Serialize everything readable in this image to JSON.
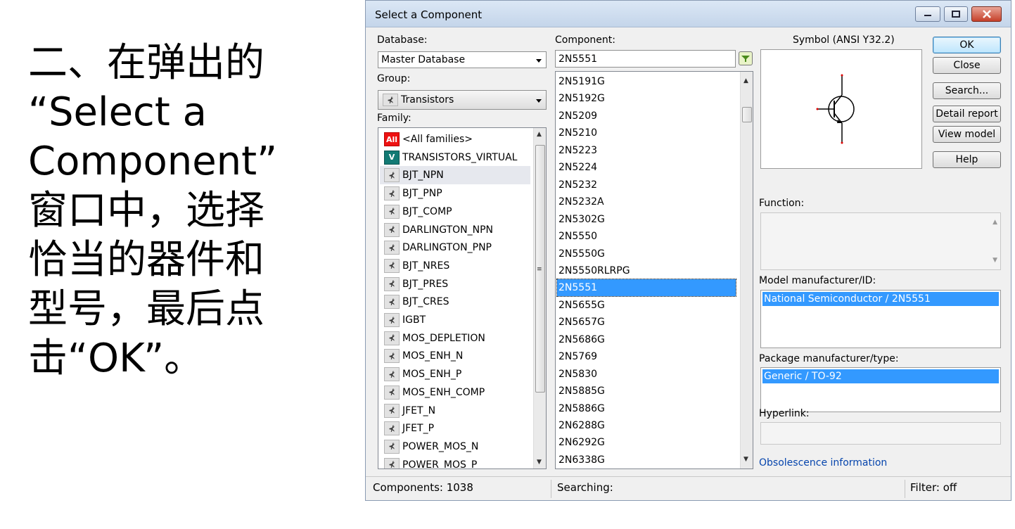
{
  "slide": {
    "lines": [
      "二、在弹出的",
      "“Select a",
      "Component”",
      "窗口中，选择",
      "恰当的器件和",
      "型号，最后点",
      "击“OK”。"
    ]
  },
  "dialog": {
    "title": "Select a Component",
    "database_label": "Database:",
    "database_value": "Master Database",
    "group_label": "Group:",
    "group_value": "Transistors",
    "family_label": "Family:",
    "families": [
      {
        "label": "<All families>",
        "icon": "All",
        "style": "red"
      },
      {
        "label": "TRANSISTORS_VIRTUAL",
        "icon": "V",
        "style": "teal"
      },
      {
        "label": "BJT_NPN",
        "icon": "npn",
        "style": "gray",
        "highlighted": true
      },
      {
        "label": "BJT_PNP",
        "icon": "pnp",
        "style": "gray"
      },
      {
        "label": "BJT_COMP",
        "icon": "cmp",
        "style": "gray"
      },
      {
        "label": "DARLINGTON_NPN",
        "icon": "dn",
        "style": "gray"
      },
      {
        "label": "DARLINGTON_PNP",
        "icon": "dp",
        "style": "gray"
      },
      {
        "label": "BJT_NRES",
        "icon": "nr",
        "style": "gray"
      },
      {
        "label": "BJT_PRES",
        "icon": "pr",
        "style": "gray"
      },
      {
        "label": "BJT_CRES",
        "icon": "cr",
        "style": "gray"
      },
      {
        "label": "IGBT",
        "icon": "ig",
        "style": "gray"
      },
      {
        "label": "MOS_DEPLETION",
        "icon": "md",
        "style": "gray"
      },
      {
        "label": "MOS_ENH_N",
        "icon": "mn",
        "style": "gray"
      },
      {
        "label": "MOS_ENH_P",
        "icon": "mp",
        "style": "gray"
      },
      {
        "label": "MOS_ENH_COMP",
        "icon": "mc",
        "style": "gray"
      },
      {
        "label": "JFET_N",
        "icon": "jn",
        "style": "gray"
      },
      {
        "label": "JFET_P",
        "icon": "jp",
        "style": "gray"
      },
      {
        "label": "POWER_MOS_N",
        "icon": "pn",
        "style": "gray"
      },
      {
        "label": "POWER_MOS_P",
        "icon": "pp",
        "style": "gray"
      }
    ],
    "component_label": "Component:",
    "component_value": "2N5551",
    "components": [
      "2N5191G",
      "2N5192G",
      "2N5209",
      "2N5210",
      "2N5223",
      "2N5224",
      "2N5232",
      "2N5232A",
      "2N5302G",
      "2N5550",
      "2N5550G",
      "2N5550RLRPG",
      "2N5551",
      "2N5655G",
      "2N5657G",
      "2N5686G",
      "2N5769",
      "2N5830",
      "2N5885G",
      "2N5886G",
      "2N6288G",
      "2N6292G",
      "2N6338G"
    ],
    "selected_component": "2N5551",
    "symbol_label": "Symbol (ANSI Y32.2)",
    "buttons": {
      "ok": "OK",
      "close": "Close",
      "search": "Search...",
      "detail_report": "Detail report",
      "view_model": "View model",
      "help": "Help"
    },
    "function_label": "Function:",
    "function_value": "",
    "model_label": "Model manufacturer/ID:",
    "model_value": "National Semiconductor / 2N5551",
    "package_label": "Package manufacturer/type:",
    "package_value": "Generic / TO-92",
    "hyperlink_label": "Hyperlink:",
    "hyperlink_value": "",
    "obsolescence_link": "Obsolescence information",
    "status": {
      "components": "Components: 1038",
      "searching": "Searching:",
      "filter": "Filter: off"
    }
  }
}
